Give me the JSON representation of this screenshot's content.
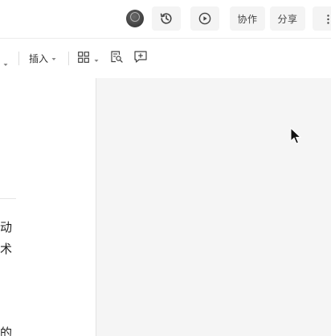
{
  "header": {
    "avatar_icon": "user-avatar",
    "history_icon": "history-clock-icon",
    "present_icon": "play-circle-icon",
    "collab_label": "协作",
    "share_label": "分享",
    "more_icon": "more-vertical-icon"
  },
  "toolbar": {
    "insert_label": "插入",
    "grid_icon": "grid-layout-icon",
    "find_icon": "document-search-icon",
    "comment_icon": "add-comment-icon"
  },
  "document": {
    "lines": [
      "动",
      "术",
      "的"
    ]
  },
  "colors": {
    "header_bg": "#ffffff",
    "button_bg": "#f4f4f4",
    "canvas_bg": "#f5f5f5",
    "text": "#333333"
  }
}
